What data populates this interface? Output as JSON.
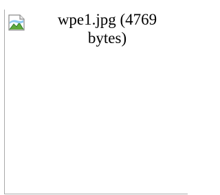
{
  "image": {
    "alt_text_line1": "wpe1.jpg (4769",
    "alt_text_line2": "bytes)",
    "icon": "broken-image-icon"
  }
}
